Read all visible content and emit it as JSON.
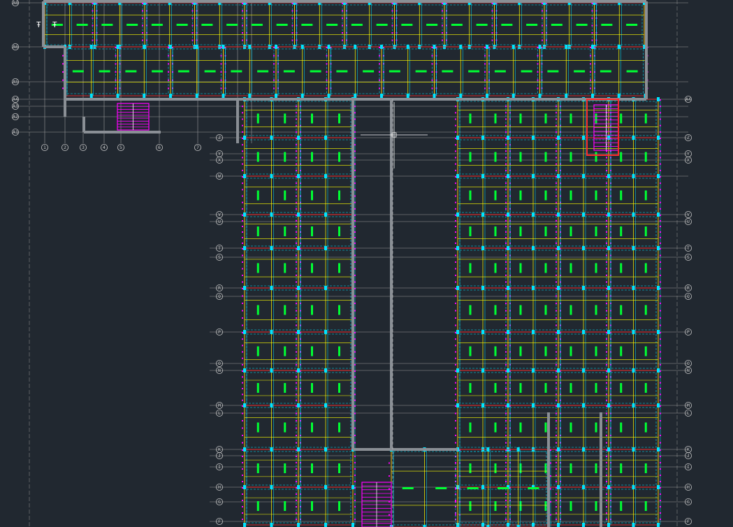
{
  "drawing": {
    "background_color": "#212830",
    "colors": {
      "grid": "#9a9a9a",
      "wall": "#8a8f95",
      "beam": "#ff2a2a",
      "column": "#ffff00",
      "rebar_cyan": "#00e5ff",
      "rebar_green": "#00ff33",
      "dim_magenta": "#ff00ff",
      "bubble": "#c8c8c8"
    },
    "icons": {
      "crosshair": "crosshair-cursor-icon",
      "stair": "stair-hatch-icon",
      "bubble": "grid-bubble-icon"
    },
    "top_left_marks": [
      "Ŧ",
      "Ŧ"
    ],
    "bubbles": {
      "left_rows": [
        "A8",
        "A6",
        "A5",
        "A4",
        "A3",
        "A2",
        "A1"
      ],
      "bottom_cols": [
        "1",
        "2",
        "3",
        "4",
        "5",
        "6",
        "7"
      ],
      "mid_left": [
        "Z",
        "Y",
        "X",
        "W",
        "V",
        "U",
        "T",
        "S",
        "R",
        "Q",
        "P",
        "O",
        "N",
        "M",
        "L",
        "K",
        "J",
        "I",
        "H",
        "G",
        "F"
      ],
      "right_side": [
        "A4",
        "Z",
        "Y",
        "X",
        "V",
        "U",
        "T",
        "S",
        "R",
        "Q",
        "P",
        "O",
        "N",
        "M",
        "L",
        "K",
        "J",
        "I",
        "H",
        "G",
        "F"
      ]
    }
  }
}
